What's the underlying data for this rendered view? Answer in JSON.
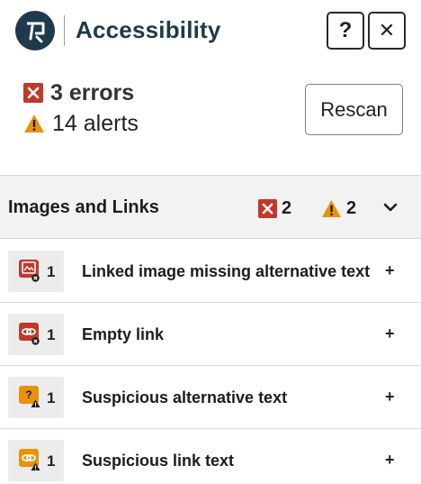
{
  "header": {
    "title": "Accessibility",
    "logo_icon": "pope-tech-logo-icon",
    "help_label": "?",
    "close_label": "✕"
  },
  "summary": {
    "errors_text": "3 errors",
    "alerts_text": "14 alerts",
    "rescan_label": "Rescan"
  },
  "group": {
    "title": "Images and Links",
    "error_count": "2",
    "alert_count": "2",
    "toggle_icon": "chevron-down-icon"
  },
  "issues": [
    {
      "label": "Linked image missing alternative text",
      "count": "1",
      "type": "error",
      "icon": "linked-image-error-icon",
      "expand": "+"
    },
    {
      "label": "Empty link",
      "count": "1",
      "type": "error",
      "icon": "empty-link-error-icon",
      "expand": "+"
    },
    {
      "label": "Suspicious alternative text",
      "count": "1",
      "type": "alert",
      "icon": "suspicious-alt-alert-icon",
      "expand": "+"
    },
    {
      "label": "Suspicious link text",
      "count": "1",
      "type": "alert",
      "icon": "suspicious-link-alert-icon",
      "expand": "+"
    }
  ],
  "colors": {
    "brand": "#1e3a4c",
    "error": "#c0392b",
    "alert": "#e8920c",
    "group_bg": "#f2f2f2"
  }
}
